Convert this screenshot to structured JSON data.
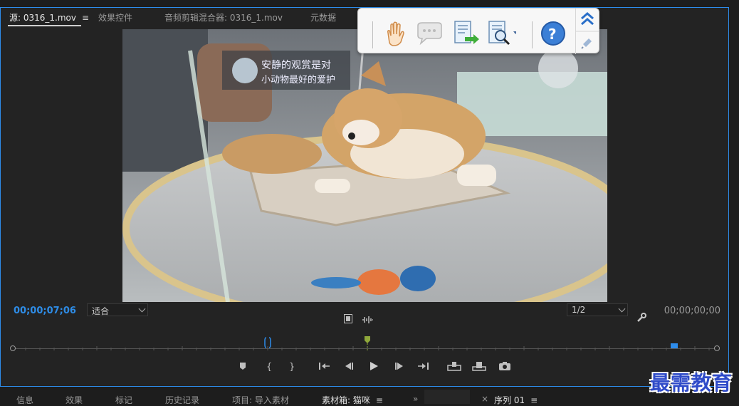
{
  "source_panel": {
    "tabs": [
      {
        "label": "源: 0316_1.mov",
        "active": true
      },
      {
        "label": "效果控件"
      },
      {
        "label": "音频剪辑混合器: 0316_1.mov"
      },
      {
        "label": "元数据"
      }
    ],
    "menu_glyph": "≡"
  },
  "video": {
    "sign_text_line1": "安静的观赏是对",
    "sign_text_line2": "小动物最好的爱护"
  },
  "controls": {
    "timecode_current": "00;00;07;06",
    "timecode_duration": "00;00;00;00",
    "zoom_select": "适合",
    "resolution_select": "1/2"
  },
  "bottom_tabs": [
    {
      "label": "信息"
    },
    {
      "label": "效果"
    },
    {
      "label": "标记"
    },
    {
      "label": "历史记录"
    },
    {
      "label": "项目: 导入素材"
    },
    {
      "label": "素材箱: 猫咪",
      "active": true
    },
    {
      "label": "»"
    },
    {
      "label": "×"
    },
    {
      "label": "序列 01"
    }
  ],
  "bottom_menu_glyph": "≡",
  "watermark": "最需教育",
  "colors": {
    "accent_blue": "#2d8ceb",
    "panel_bg": "#232323",
    "playhead_green": "#8fa83b"
  }
}
